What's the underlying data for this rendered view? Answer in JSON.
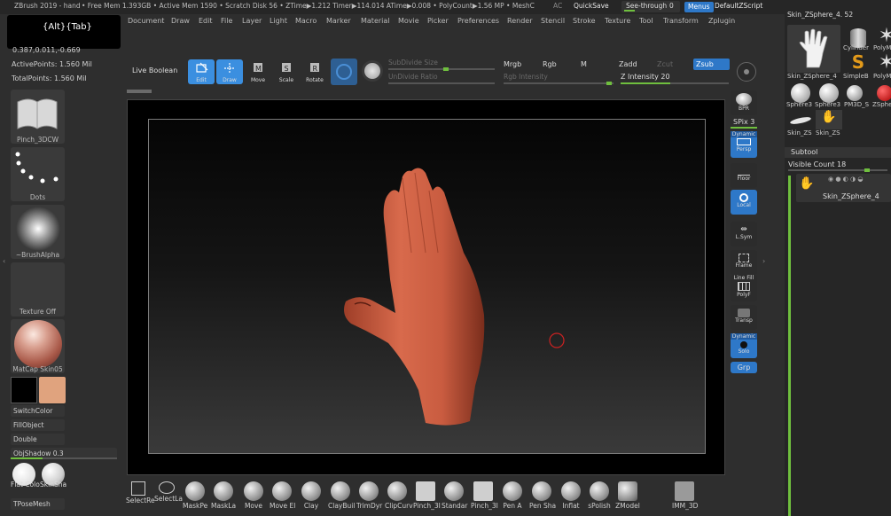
{
  "titlebar": {
    "app_text": "ZBrush 2019 - hand",
    "status_text": "• Free Mem 1.393GB • Active Mem 1590 • Scratch Disk 56 • ZTime▶1.212 Timer▶114.014 ATime▶0.008 • PolyCount▶1.56 MP • MeshC",
    "ac": "AC",
    "quicksave": "QuickSave",
    "see_through_label": "See-through",
    "see_through_value": "0",
    "menus_button": "Menus",
    "default_zscript": "DefaultZScript"
  },
  "menubar": [
    "Document",
    "Draw",
    "Edit",
    "File",
    "Layer",
    "Light",
    "Macro",
    "Marker",
    "Material",
    "Movie",
    "Picker",
    "Preferences",
    "Render",
    "Stencil",
    "Stroke",
    "Texture",
    "Tool",
    "Transform",
    "Zplugin"
  ],
  "tooltip": "{Alt}{Tab}",
  "left_info": {
    "coords": "0.387,0.011,-0.669",
    "active_points": "ActivePoints: 1.560 Mil",
    "total_points": "TotalPoints: 1.560 Mil"
  },
  "left_shelf": {
    "brush": "Pinch_3DCW",
    "stroke": "Dots",
    "alpha": "~BrushAlpha",
    "texture": "Texture Off",
    "material": "MatCap Skin05",
    "switch_color": "SwitchColor",
    "fill_object": "FillObject",
    "double": "Double",
    "obj_shadow": "ObjShadow 0.3",
    "obj_shadow_level": 0.3,
    "flat_color": "Flat Colo",
    "skin_shade": "SkinSha",
    "tpose_mesh": "TPoseMesh",
    "main_color": "#e0a37e",
    "secondary_color": "#000000"
  },
  "toolbar": {
    "live_boolean": "Live Boolean",
    "edit": "Edit",
    "draw": "Draw",
    "move": "Move",
    "scale": "Scale",
    "rotate": "Rotate",
    "subdivide_size": "SubDivide Size",
    "undivide_ratio": "UnDivide Ratio",
    "mrgb": "Mrgb",
    "rgb": "Rgb",
    "m": "M",
    "rgb_intensity": "Rgb Intensity",
    "zadd": "Zadd",
    "zcut": "Zcut",
    "zsub": "Zsub",
    "z_intensity": "Z Intensity 20"
  },
  "right_tray": {
    "bpr": "BPR",
    "spix": "SPix 3",
    "dynamic": "Dynamic",
    "persp": "Persp",
    "floor": "Floor",
    "local": "Local",
    "lsym": "L.Sym",
    "frame": "Frame",
    "line_fill": "Line Fill",
    "polyf": "PolyF",
    "transp": "Transp",
    "solo": "Solo",
    "dynamic2": "Dynamic",
    "grp": "Grp"
  },
  "right_panel": {
    "current_tool": "Skin_ZSphere_4. 52",
    "tools": [
      {
        "label": "Skin_ZSphere_4"
      },
      {
        "label": "Cylinder"
      },
      {
        "label": "PolyM"
      },
      {
        "label": "SimpleB"
      },
      {
        "label": "PolyM"
      },
      {
        "label": "Sphere3"
      },
      {
        "label": "Sphere3"
      },
      {
        "label": "PM3D_S"
      },
      {
        "label": "ZSphe"
      },
      {
        "label": "Skin_ZS"
      },
      {
        "label": "Skin_ZS"
      }
    ],
    "subtool_header": "Subtool",
    "visible_count": "Visible Count 18",
    "subtool_item": "Skin_ZSphere_4"
  },
  "bottom_shelf": [
    "SelectRe",
    "SelectLa",
    "MaskPe",
    "MaskLa",
    "Move",
    "Move El",
    "Clay",
    "ClayBuil",
    "TrimDyr",
    "ClipCurv",
    "Pinch_3I",
    "Standar",
    "Pinch_3I",
    "Pen A",
    "Pen Sha",
    "Inflat",
    "sPolish",
    "ZModel",
    "IMM_3D"
  ]
}
